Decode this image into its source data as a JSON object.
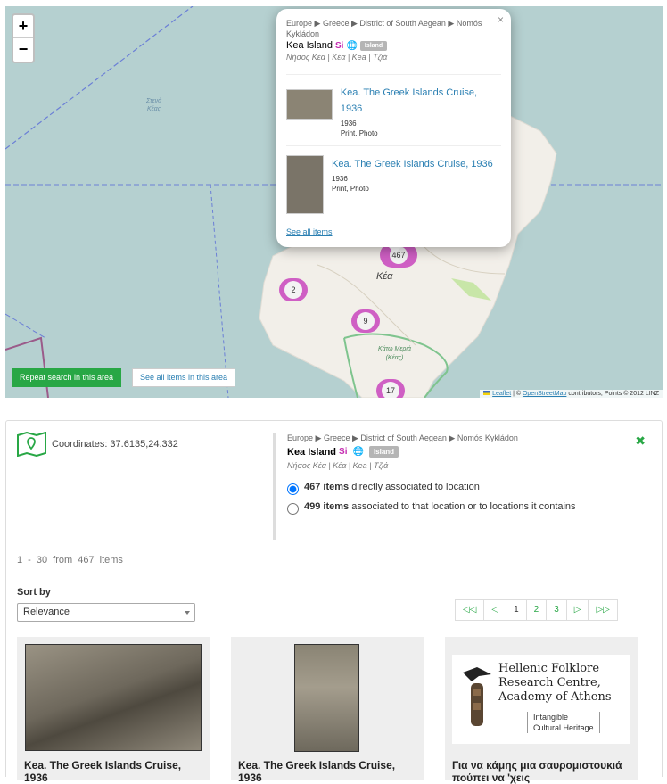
{
  "map": {
    "zoom_in": "+",
    "zoom_out": "−",
    "sea_label_line1": "Στενά",
    "sea_label_line2": "Κέας",
    "island_label": "Κέα",
    "village_label_line1": "Κάτω Μεριά",
    "village_label_line2": "(Κέας)",
    "clusters": [
      "467",
      "2",
      "9",
      "17"
    ],
    "repeat_search": "Repeat search in this area",
    "see_all_area": "See all items in this area",
    "attribution": {
      "leaflet": "Leaflet",
      "osm": "OpenStreetMap",
      "rest": "contributors, Points © 2012 LINZ"
    }
  },
  "popup": {
    "close": "×",
    "breadcrumb": "Europe ▶ Greece ▶ District of South Aegean ▶ Nomós Kykládon",
    "place_name": "Kea Island",
    "si": "Si",
    "badge": "Island",
    "alt_names": "Νήσος Κέα | Κέα | Kea | Τζιά",
    "items": [
      {
        "title": "Kea. The Greek Islands Cruise, 1936",
        "year": "1936",
        "type": "Print, Photo"
      },
      {
        "title": "Kea. The Greek Islands Cruise, 1936",
        "year": "1936",
        "type": "Print, Photo"
      }
    ],
    "see_all": "See all items"
  },
  "panel": {
    "coordinates": "Coordinates: 37.6135,24.332",
    "breadcrumb": "Europe ▶ Greece ▶ District of South Aegean ▶ Nomós Kykládon",
    "place_name": "Kea Island",
    "si": "Si",
    "badge": "Island",
    "alt_names": "Νήσος Κέα | Κέα | Kea | Τζιά",
    "option1_count": "467",
    "option1_items": "items",
    "option1_text": "directly associated to location",
    "option2_count": "499",
    "option2_items": "items",
    "option2_text": "associated to that location or to locations it contains",
    "close": "✖",
    "range": "1 - 30 from 467 items",
    "sort_label": "Sort by",
    "sort_value": "Relevance",
    "pager": [
      "◁◁",
      "◁",
      "1",
      "2",
      "3",
      "▷",
      "▷▷"
    ],
    "cards": [
      {
        "title": "Kea. The Greek Islands Cruise, 1936"
      },
      {
        "title": "Kea. The Greek Islands Cruise, 1936"
      },
      {
        "title": "Για να κάμης μια σαυρομιστουκιά πούπει να 'χεις"
      }
    ],
    "logo": {
      "line1": "Hellenic Folklore",
      "line2": "Research Centre,",
      "line3": "Academy of Athens",
      "sub1": "Intangible",
      "sub2": "Cultural Heritage"
    }
  }
}
